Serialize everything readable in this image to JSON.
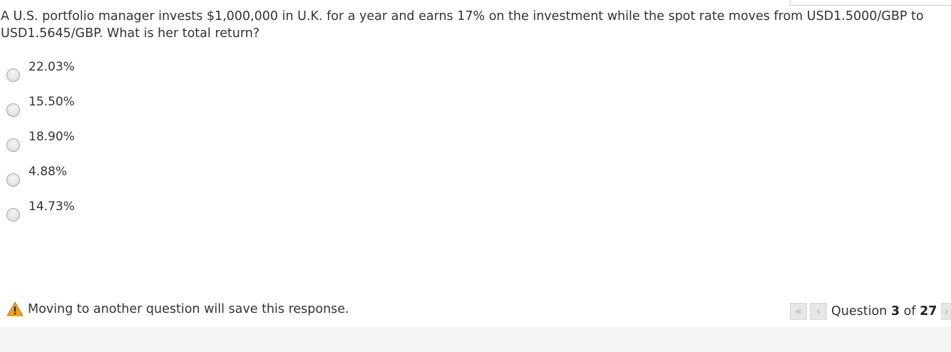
{
  "question": {
    "text": "A U.S. portfolio manager invests $1,000,000 in U.K. for a year and earns 17% on the investment while the spot rate moves from USD1.5000/GBP to USD1.5645/GBP. What is her total return?"
  },
  "answers": [
    {
      "label": "22.03%"
    },
    {
      "label": "15.50%"
    },
    {
      "label": "18.90%"
    },
    {
      "label": "4.88%"
    },
    {
      "label": "14.73%"
    }
  ],
  "footer": {
    "warning_text": "Moving to another question will save this response.",
    "warning_icon": "warning-triangle-icon",
    "warning_color": "#f0a020"
  },
  "navigation": {
    "first_icon": "«",
    "prev_icon": "‹",
    "next_icon": "›",
    "prefix": "Question",
    "current": "3",
    "of": "of",
    "total": "27"
  }
}
